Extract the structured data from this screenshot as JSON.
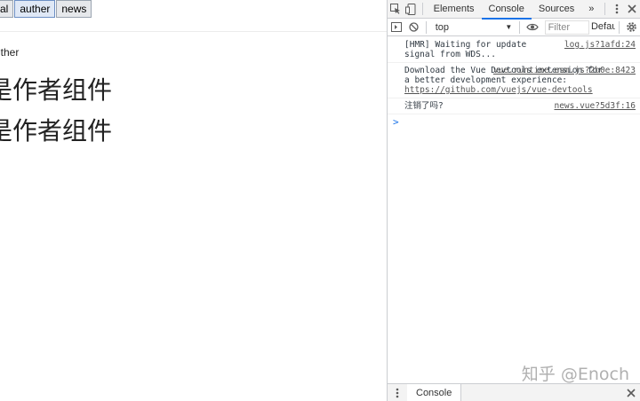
{
  "page": {
    "nav_buttons": [
      {
        "label": "al"
      },
      {
        "label": "auther",
        "active": true
      },
      {
        "label": "news"
      }
    ],
    "route_label": "uther",
    "heading_1": "是作者组件",
    "heading_2": "是作者组件"
  },
  "devtools": {
    "tabs": {
      "elements": "Elements",
      "console": "Console",
      "sources": "Sources",
      "more": "»"
    },
    "toolbar": {
      "context": "top",
      "filter_placeholder": "Filter",
      "levels": "Defau"
    },
    "messages": [
      {
        "text": "[HMR] Waiting for update signal from WDS...",
        "source": "log.js?1afd:24"
      },
      {
        "text": "Download the Vue Devtools extension for a better development experience:",
        "link": "https://github.com/vuejs/vue-devtools",
        "source": "vue.runtime.esm.js?2b0e:8423"
      },
      {
        "text": "注销了吗?",
        "source": "news.vue?5d3f:16"
      }
    ],
    "prompt": ">",
    "drawer_tab": "Console"
  },
  "watermark": "知乎 @Enoch",
  "colors": {
    "accent": "#1a73e8",
    "toolbar_bg": "#f3f3f3",
    "border": "#cbcdd1"
  }
}
